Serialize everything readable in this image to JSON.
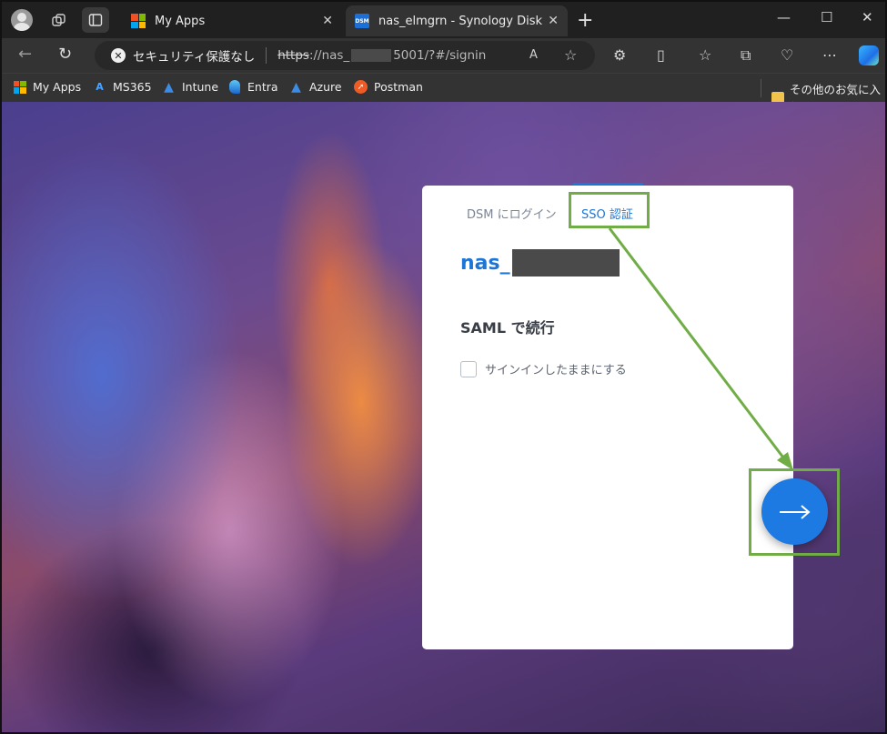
{
  "browser": {
    "tabs": [
      {
        "title": "My Apps",
        "close": "✕"
      },
      {
        "title": "nas_elmgrn - Synology DiskStation",
        "favicon_text": "DSM",
        "close": "✕"
      }
    ],
    "new_tab": "+",
    "window_controls": {
      "minimize": "—",
      "maximize": "☐",
      "close": "✕"
    }
  },
  "toolbar": {
    "security_label": "セキュリティ保護なし",
    "url_scheme": "https",
    "url_host_prefix": "://nas_",
    "url_suffix": "5001/?#/signin"
  },
  "bookmarks": {
    "items": [
      "My Apps",
      "MS365",
      "Intune",
      "Entra",
      "Azure",
      "Postman"
    ],
    "other_favorites": "その他のお気に入り"
  },
  "login": {
    "tabs": {
      "dsm": "DSM にログイン",
      "sso": "SSO 認証"
    },
    "server_name_prefix": "nas_",
    "saml_title": "SAML で続行",
    "remember_label": "サインインしたままにする"
  },
  "colors": {
    "accent": "#1d76d6",
    "button": "#1e7ae3",
    "annotation": "#71ad47",
    "chrome_dark": "#202020",
    "chrome_toolbar": "#333333"
  }
}
